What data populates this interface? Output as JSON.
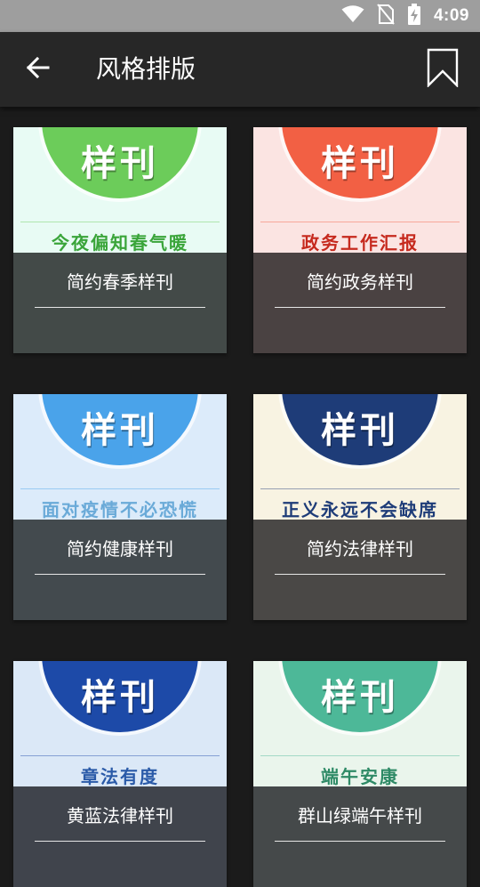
{
  "status_bar": {
    "time": "4:09",
    "icons": [
      "wifi-icon",
      "no-sim-icon",
      "battery-charging-icon"
    ]
  },
  "app_bar": {
    "title": "风格排版",
    "back_icon": "arrow-left-icon",
    "action_icon": "bookmark-icon"
  },
  "templates": [
    {
      "name": "简约春季样刊",
      "thumb_word": "样刊",
      "thumb_subtitle": "今夜偏知春气暖",
      "thumb_bg": "#e8fbf4",
      "circle_color": "#6ccc5a",
      "subtitle_color": "#3aa53a",
      "panel_color": "#434a48"
    },
    {
      "name": "简约政务样刊",
      "thumb_word": "样刊",
      "thumb_subtitle": "政务工作汇报",
      "thumb_bg": "#fbe4e2",
      "circle_color": "#f26044",
      "subtitle_color": "#c62a1e",
      "panel_color": "#4a4242"
    },
    {
      "name": "简约健康样刊",
      "thumb_word": "样刊",
      "thumb_subtitle": "面对疫情不必恐慌",
      "thumb_bg": "#dcebfa",
      "circle_color": "#4aa3ea",
      "subtitle_color": "#6aaad8",
      "panel_color": "#434a4e"
    },
    {
      "name": "简约法律样刊",
      "thumb_word": "样刊",
      "thumb_subtitle": "正义永远不会缺席",
      "thumb_bg": "#f8f3e2",
      "circle_color": "#1e3c78",
      "subtitle_color": "#1e3c78",
      "panel_color": "#4a4846"
    },
    {
      "name": "黄蓝法律样刊",
      "thumb_word": "样刊",
      "thumb_subtitle": "章法有度",
      "thumb_bg": "#dbe8f7",
      "circle_color": "#1d4aa8",
      "subtitle_color": "#2a5aa8",
      "panel_color": "#40444c"
    },
    {
      "name": "群山绿端午样刊",
      "thumb_word": "样刊",
      "thumb_subtitle": "端午安康",
      "thumb_bg": "#eaf5ec",
      "circle_color": "#4db898",
      "subtitle_color": "#2e8a66",
      "panel_color": "#45494a"
    }
  ]
}
